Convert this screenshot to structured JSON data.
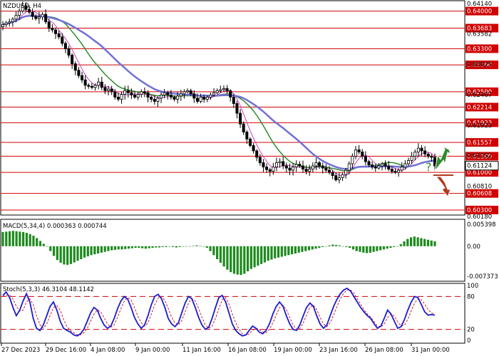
{
  "chart_data": [
    {
      "type": "candlestick",
      "title": "NZDUSD, H4",
      "price_ticks": [
        "0.64140",
        "0.63582",
        "0.63025",
        "0.62467",
        "0.61923",
        "0.61352",
        "0.60810",
        "0.60180"
      ],
      "level_lines": [
        {
          "value": 0.64,
          "label": "0.64000"
        },
        {
          "value": 0.63683,
          "label": "0.63683"
        },
        {
          "value": 0.633,
          "label": "0.63300"
        },
        {
          "value": 0.63,
          "label": "0.63000"
        },
        {
          "value": 0.625,
          "label": "0.62500"
        },
        {
          "value": 0.62214,
          "label": "0.62214"
        },
        {
          "value": 0.61923,
          "label": "0.61923"
        },
        {
          "value": 0.61557,
          "label": "0.61557"
        },
        {
          "value": 0.613,
          "label": "0.61300"
        },
        {
          "value": 0.61,
          "label": "0.61000"
        },
        {
          "value": 0.60608,
          "label": "0.60608"
        },
        {
          "value": 0.603,
          "label": "0.60300"
        }
      ],
      "current_price": {
        "value": 0.61124,
        "label": "0.61124"
      },
      "x_labels": [
        "27 Dec 2023",
        "29 Dec 16:00",
        "4 Jan 08:00",
        "9 Jan 00:00",
        "11 Jan 16:00",
        "16 Jan 08:00",
        "19 Jan 00:00",
        "23 Jan 16:00",
        "26 Jan 08:00",
        "31 Jan 00:00"
      ],
      "annotation": "?",
      "colors": {
        "level": "#d00000",
        "ma_fast": "#d040c0",
        "ma_mid": "#2e8b2e",
        "ma_slow": "#7070d8",
        "up_arrow": "#2e8b2e",
        "down_arrow": "#b03a1e"
      },
      "close_path": [
        0.6375,
        0.6378,
        0.638,
        0.6385,
        0.6392,
        0.64,
        0.641,
        0.6403,
        0.6398,
        0.639,
        0.6386,
        0.6389,
        0.6394,
        0.638,
        0.6368,
        0.6365,
        0.6358,
        0.6352,
        0.634,
        0.633,
        0.6318,
        0.6302,
        0.629,
        0.628,
        0.6272,
        0.6262,
        0.626,
        0.6258,
        0.6262,
        0.6268,
        0.6258,
        0.6252,
        0.6255,
        0.625,
        0.624,
        0.6236,
        0.6245,
        0.6252,
        0.6248,
        0.6244,
        0.624,
        0.6245,
        0.625,
        0.6248,
        0.624,
        0.6236,
        0.6232,
        0.6238,
        0.6244,
        0.6248,
        0.6244,
        0.624,
        0.6236,
        0.6242,
        0.6246,
        0.625,
        0.6252,
        0.6246,
        0.6238,
        0.6232,
        0.624,
        0.6236,
        0.624,
        0.6244,
        0.6248,
        0.6252,
        0.6254,
        0.6256,
        0.6252,
        0.624,
        0.6228,
        0.621,
        0.619,
        0.6175,
        0.6162,
        0.615,
        0.614,
        0.6128,
        0.6118,
        0.611,
        0.6105,
        0.6102,
        0.611,
        0.6118,
        0.612,
        0.6112,
        0.6108,
        0.6104,
        0.611,
        0.6115,
        0.6112,
        0.6106,
        0.6102,
        0.6106,
        0.6112,
        0.6118,
        0.6112,
        0.6108,
        0.6104,
        0.61,
        0.6094,
        0.6086,
        0.609,
        0.6096,
        0.6104,
        0.6116,
        0.613,
        0.6142,
        0.6138,
        0.613,
        0.612,
        0.6114,
        0.611,
        0.6108,
        0.6112,
        0.6116,
        0.6112,
        0.6106,
        0.6102,
        0.61,
        0.6104,
        0.611,
        0.6116,
        0.6122,
        0.613,
        0.6138,
        0.6145,
        0.614,
        0.6134,
        0.613,
        0.6128,
        0.6112
      ],
      "indicator_panels": [
        {
          "name": "MACD(5,34,4) 0.000363 0.000744",
          "ticks": [
            "0.005398",
            "0.00",
            "-0.007373"
          ],
          "range": [
            -0.0083,
            0.0063
          ],
          "zero": 0,
          "colors": {
            "hist": "#1d8a1d"
          },
          "histogram": [
            0.0035,
            0.0036,
            0.0037,
            0.0038,
            0.0037,
            0.0036,
            0.0035,
            0.0033,
            0.003,
            0.0026,
            0.002,
            0.0013,
            0.0006,
            0.0,
            -0.0012,
            -0.0024,
            -0.0034,
            -0.0041,
            -0.0045,
            -0.0046,
            -0.0044,
            -0.004,
            -0.0036,
            -0.0032,
            -0.0028,
            -0.0025,
            -0.0022,
            -0.002,
            -0.0018,
            -0.0016,
            -0.0014,
            -0.0012,
            -0.001,
            -0.0009,
            -0.0008,
            -0.0008,
            -0.0007,
            -0.0006,
            -0.0005,
            -0.0004,
            -0.0004,
            -0.0005,
            -0.0006,
            -0.0005,
            -0.0004,
            -0.0003,
            -0.0003,
            -0.0002,
            -0.0002,
            -0.0001,
            -0.0002,
            -0.0003,
            -0.0002,
            -0.0001,
            -0.0001,
            0.0,
            0.0001,
            0.0002,
            0.0001,
            0.0,
            -0.0004,
            -0.0012,
            -0.0022,
            -0.0032,
            -0.0041,
            -0.005,
            -0.0058,
            -0.0064,
            -0.0068,
            -0.007,
            -0.0071,
            -0.0068,
            -0.0062,
            -0.0056,
            -0.0052,
            -0.0048,
            -0.0044,
            -0.004,
            -0.0036,
            -0.0033,
            -0.003,
            -0.0028,
            -0.0026,
            -0.0024,
            -0.0022,
            -0.002,
            -0.0018,
            -0.0016,
            -0.0014,
            -0.0012,
            -0.001,
            -0.0008,
            -0.0006,
            -0.0004,
            -0.0002,
            0.0,
            0.0002,
            0.0004,
            0.0003,
            0.0002,
            0.0,
            -0.0002,
            -0.0004,
            -0.0008,
            -0.0012,
            -0.0014,
            -0.0016,
            -0.0017,
            -0.0016,
            -0.0014,
            -0.0012,
            -0.001,
            -0.0008,
            -0.0006,
            -0.0004,
            -0.0002,
            0.0,
            0.0005,
            0.0012,
            0.0018,
            0.0022,
            0.0024,
            0.0022,
            0.002,
            0.0018,
            0.0016,
            0.0014,
            0.0012
          ]
        },
        {
          "name": "Stoch(5,3,3) 46.3104 48.1142",
          "ticks": [
            "100",
            "80",
            "20",
            "0"
          ],
          "range": [
            0,
            100
          ],
          "levels": [
            80,
            20
          ],
          "colors": {
            "main": "#1a1ad0",
            "signal": "#d02020",
            "level": "#d00000"
          },
          "main": [
            82,
            88,
            78,
            60,
            45,
            55,
            72,
            85,
            70,
            40,
            22,
            18,
            28,
            45,
            62,
            70,
            55,
            35,
            22,
            18,
            15,
            10,
            8,
            12,
            20,
            35,
            50,
            60,
            55,
            40,
            28,
            22,
            26,
            40,
            58,
            72,
            80,
            75,
            60,
            42,
            30,
            22,
            28,
            45,
            65,
            80,
            84,
            76,
            60,
            40,
            30,
            25,
            32,
            50,
            68,
            80,
            76,
            60,
            42,
            28,
            20,
            24,
            40,
            60,
            78,
            82,
            70,
            50,
            30,
            18,
            12,
            8,
            10,
            18,
            26,
            22,
            15,
            12,
            18,
            30,
            48,
            62,
            70,
            62,
            45,
            30,
            20,
            18,
            28,
            45,
            60,
            68,
            62,
            45,
            30,
            22,
            28,
            45,
            62,
            75,
            85,
            92,
            95,
            90,
            80,
            70,
            60,
            52,
            45,
            40,
            30,
            22,
            26,
            40,
            55,
            48,
            35,
            22,
            25,
            38,
            55,
            70,
            80,
            78,
            65,
            52,
            46,
            47,
            46
          ],
          "signal": [
            80,
            82,
            83,
            75,
            62,
            53,
            55,
            70,
            76,
            65,
            45,
            28,
            22,
            30,
            45,
            60,
            63,
            55,
            38,
            25,
            18,
            14,
            10,
            10,
            14,
            22,
            35,
            48,
            55,
            52,
            42,
            30,
            24,
            28,
            42,
            58,
            72,
            78,
            74,
            60,
            44,
            32,
            26,
            32,
            48,
            65,
            77,
            80,
            73,
            58,
            42,
            32,
            28,
            36,
            52,
            68,
            76,
            72,
            58,
            42,
            28,
            22,
            26,
            40,
            58,
            74,
            78,
            66,
            48,
            32,
            20,
            12,
            9,
            12,
            18,
            22,
            20,
            15,
            14,
            20,
            32,
            46,
            60,
            64,
            56,
            42,
            28,
            20,
            22,
            32,
            46,
            60,
            64,
            56,
            42,
            30,
            25,
            32,
            46,
            62,
            76,
            86,
            92,
            92,
            86,
            76,
            66,
            56,
            48,
            42,
            34,
            26,
            24,
            30,
            42,
            48,
            44,
            34,
            26,
            28,
            38,
            54,
            68,
            76,
            74,
            66,
            56,
            50,
            48
          ]
        }
      ]
    }
  ]
}
